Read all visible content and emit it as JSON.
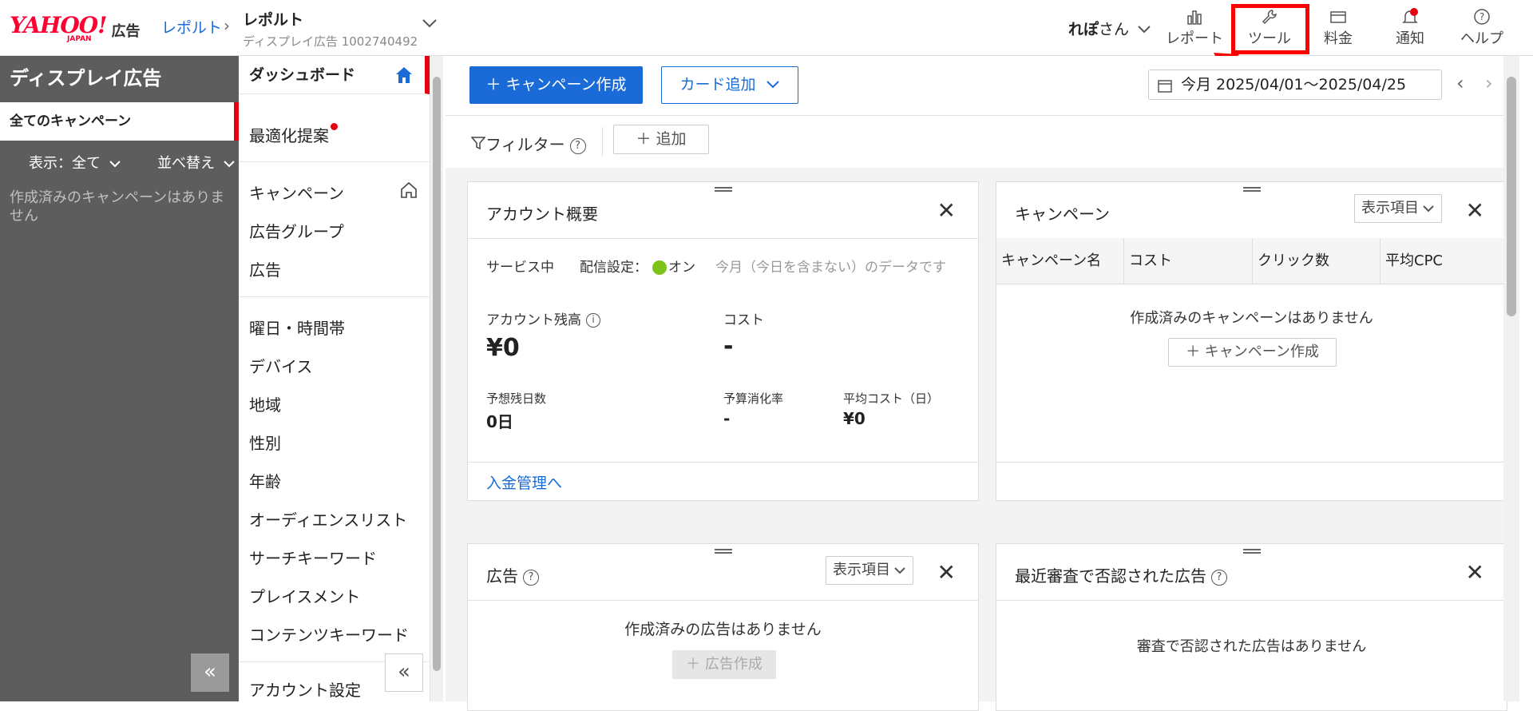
{
  "header": {
    "logo_text": "YAHOO!",
    "logo_sub": "JAPAN",
    "logo_ad": "広告",
    "breadcrumb": "レポルト",
    "account_name": "レポルト",
    "account_sub": "ディスプレイ広告 1002740492",
    "user_name": "れぽ",
    "user_suffix": "さん",
    "nav": {
      "report": "レポート",
      "tools": "ツール",
      "fees": "料金",
      "notify": "通知",
      "help": "ヘルプ"
    },
    "highlight_color": "#ff0000"
  },
  "left_panel": {
    "title": "ディスプレイ広告",
    "selected": "全てのキャンペーン",
    "display_label": "表示：全て",
    "sort_label": "並べ替え",
    "empty_text": "作成済みのキャンペーンはありません",
    "collapse": "«"
  },
  "nav": {
    "dashboard": "ダッシュボード",
    "optimize": "最適化提案",
    "campaign": "キャンペーン",
    "adgroup": "広告グループ",
    "ad": "広告",
    "day_time": "曜日・時間帯",
    "device": "デバイス",
    "region": "地域",
    "gender": "性別",
    "age": "年齢",
    "audience": "オーディエンスリスト",
    "search_kw": "サーチキーワード",
    "placement": "プレイスメント",
    "content_kw": "コンテンツキーワード",
    "account_settings": "アカウント設定",
    "collapse": "«"
  },
  "toolbar": {
    "create_campaign": "＋ キャンペーン作成",
    "add_card": "カード追加",
    "date_range": "今月 2025/04/01～2025/04/25",
    "filter": "フィルター",
    "add": "＋ 追加"
  },
  "account_card": {
    "title": "アカウント概要",
    "service": "サービス中",
    "delivery_label": "配信設定：",
    "delivery_value": "オン",
    "note": "今月（今日を含まない）のデータです",
    "balance_label": "アカウント残高",
    "balance_value": "¥0",
    "cost_label": "コスト",
    "cost_value": "-",
    "days_label": "予想残日数",
    "days_value": "0日",
    "budget_label": "予算消化率",
    "budget_value": "-",
    "avg_cost_label": "平均コスト（日）",
    "avg_cost_value": "¥0",
    "link": "入金管理へ"
  },
  "campaign_card": {
    "title": "キャンペーン",
    "display_items": "表示項目",
    "columns": [
      "キャンペーン名",
      "コスト",
      "クリック数",
      "平均CPC"
    ],
    "empty": "作成済みのキャンペーンはありません",
    "create": "＋ キャンペーン作成"
  },
  "ad_card": {
    "title": "広告",
    "display_items": "表示項目",
    "empty": "作成済みの広告はありません",
    "create": "＋ 広告作成"
  },
  "rejected_card": {
    "title": "最近審査で否認された広告",
    "empty": "審査で否認された広告はありません"
  }
}
